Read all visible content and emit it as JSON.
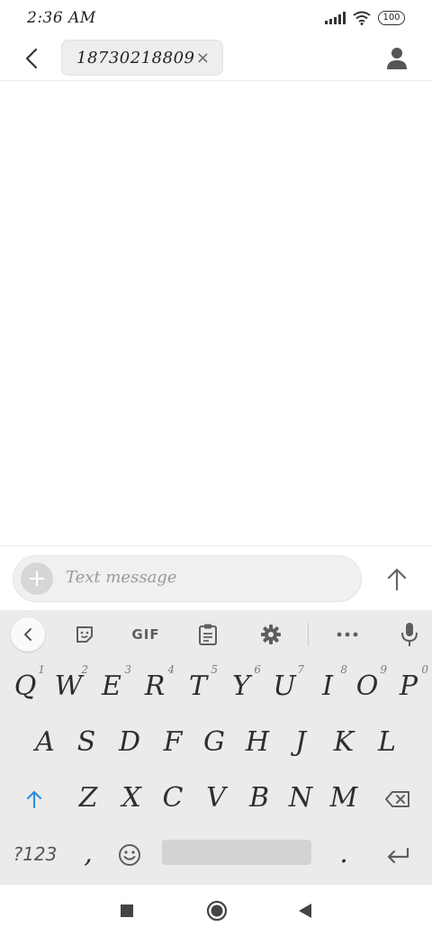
{
  "status_bar": {
    "time": "2:36 AM",
    "battery": "100"
  },
  "header": {
    "back_icon": "chevron-left-icon",
    "recipient": "18730218809",
    "remove_icon": "close-icon",
    "contact_icon": "person-icon"
  },
  "compose": {
    "add_icon": "plus-icon",
    "placeholder": "Text message",
    "send_icon": "arrow-up-icon"
  },
  "keyboard": {
    "toolbar": {
      "collapse_icon": "chevron-left-icon",
      "sticker_icon": "sticker-icon",
      "gif_label": "GIF",
      "clipboard_icon": "clipboard-icon",
      "settings_icon": "gear-icon",
      "more_icon": "more-horizontal-icon",
      "mic_icon": "microphone-icon"
    },
    "row1": [
      {
        "key": "Q",
        "hint": "1"
      },
      {
        "key": "W",
        "hint": "2"
      },
      {
        "key": "E",
        "hint": "3"
      },
      {
        "key": "R",
        "hint": "4"
      },
      {
        "key": "T",
        "hint": "5"
      },
      {
        "key": "Y",
        "hint": "6"
      },
      {
        "key": "U",
        "hint": "7"
      },
      {
        "key": "I",
        "hint": "8"
      },
      {
        "key": "O",
        "hint": "9"
      },
      {
        "key": "P",
        "hint": "0"
      }
    ],
    "row2": [
      "A",
      "S",
      "D",
      "F",
      "G",
      "H",
      "J",
      "K",
      "L"
    ],
    "row3": [
      "Z",
      "X",
      "C",
      "V",
      "B",
      "N",
      "M"
    ],
    "shift_icon": "shift-arrow-icon",
    "backspace_icon": "backspace-icon",
    "symbols_label": "?123",
    "comma_label": ",",
    "emoji_icon": "emoji-icon",
    "period_label": ".",
    "enter_icon": "enter-icon"
  },
  "nav_bar": {
    "recents_icon": "square-icon",
    "home_icon": "circle-icon",
    "back_icon": "triangle-back-icon"
  },
  "colors": {
    "accent": "#2f8fe0",
    "key_text": "#2e2e2e",
    "keyboard_bg": "#ebebeb"
  }
}
